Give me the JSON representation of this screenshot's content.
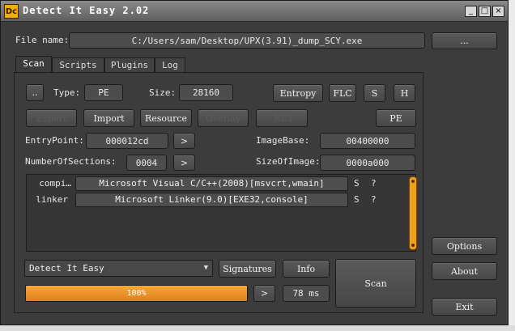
{
  "window": {
    "title": "Detect It Easy 2.02",
    "icon_text": "Dc",
    "controls": {
      "minimize": "_",
      "maximize": "□",
      "close": "×"
    }
  },
  "file": {
    "label": "File name:",
    "path": "C:/Users/sam/Desktop/UPX(3.91)_dump_SCY.exe",
    "browse_label": "..."
  },
  "tabs": [
    {
      "label": "Scan",
      "active": true
    },
    {
      "label": "Scripts",
      "active": false
    },
    {
      "label": "Plugins",
      "active": false
    },
    {
      "label": "Log",
      "active": false
    }
  ],
  "scan": {
    "dots_button": "..",
    "type_label": "Type:",
    "type_value": "PE",
    "size_label": "Size:",
    "size_value": "28160",
    "entropy_button": "Entropy",
    "flc_button": "FLC",
    "s_button": "S",
    "h_button": "H",
    "row2": {
      "export": "Export",
      "import": "Import",
      "resource": "Resource",
      "overlay": "Overlay",
      "net": ".NET",
      "pe": "PE"
    },
    "entry_point_label": "EntryPoint:",
    "entry_point_value": "000012cd",
    "arrow_label": ">",
    "image_base_label": "ImageBase:",
    "image_base_value": "00400000",
    "sections_label": "NumberOfSections:",
    "sections_value": "0004",
    "size_of_image_label": "SizeOfImage:",
    "size_of_image_value": "0000a000",
    "results": [
      {
        "name": "compi…",
        "value": "Microsoft Visual C/C++(2008)[msvcrt,wmain]",
        "s": "S",
        "q": "?"
      },
      {
        "name": "linker",
        "value": "Microsoft Linker(9.0)[EXE32,console]",
        "s": "S",
        "q": "?"
      }
    ]
  },
  "bottom": {
    "engine_select": "Detect It Easy",
    "signatures_button": "Signatures",
    "info_button": "Info",
    "scan_button": "Scan",
    "progress_value": 100,
    "progress_text": "100%",
    "progress_arrow": ">",
    "time_text": "78 ms"
  },
  "side": {
    "options_button": "Options",
    "about_button": "About",
    "exit_button": "Exit"
  },
  "colors": {
    "background": "#3c3c3c",
    "accent_orange": "#f0a020",
    "button": "#505050"
  }
}
